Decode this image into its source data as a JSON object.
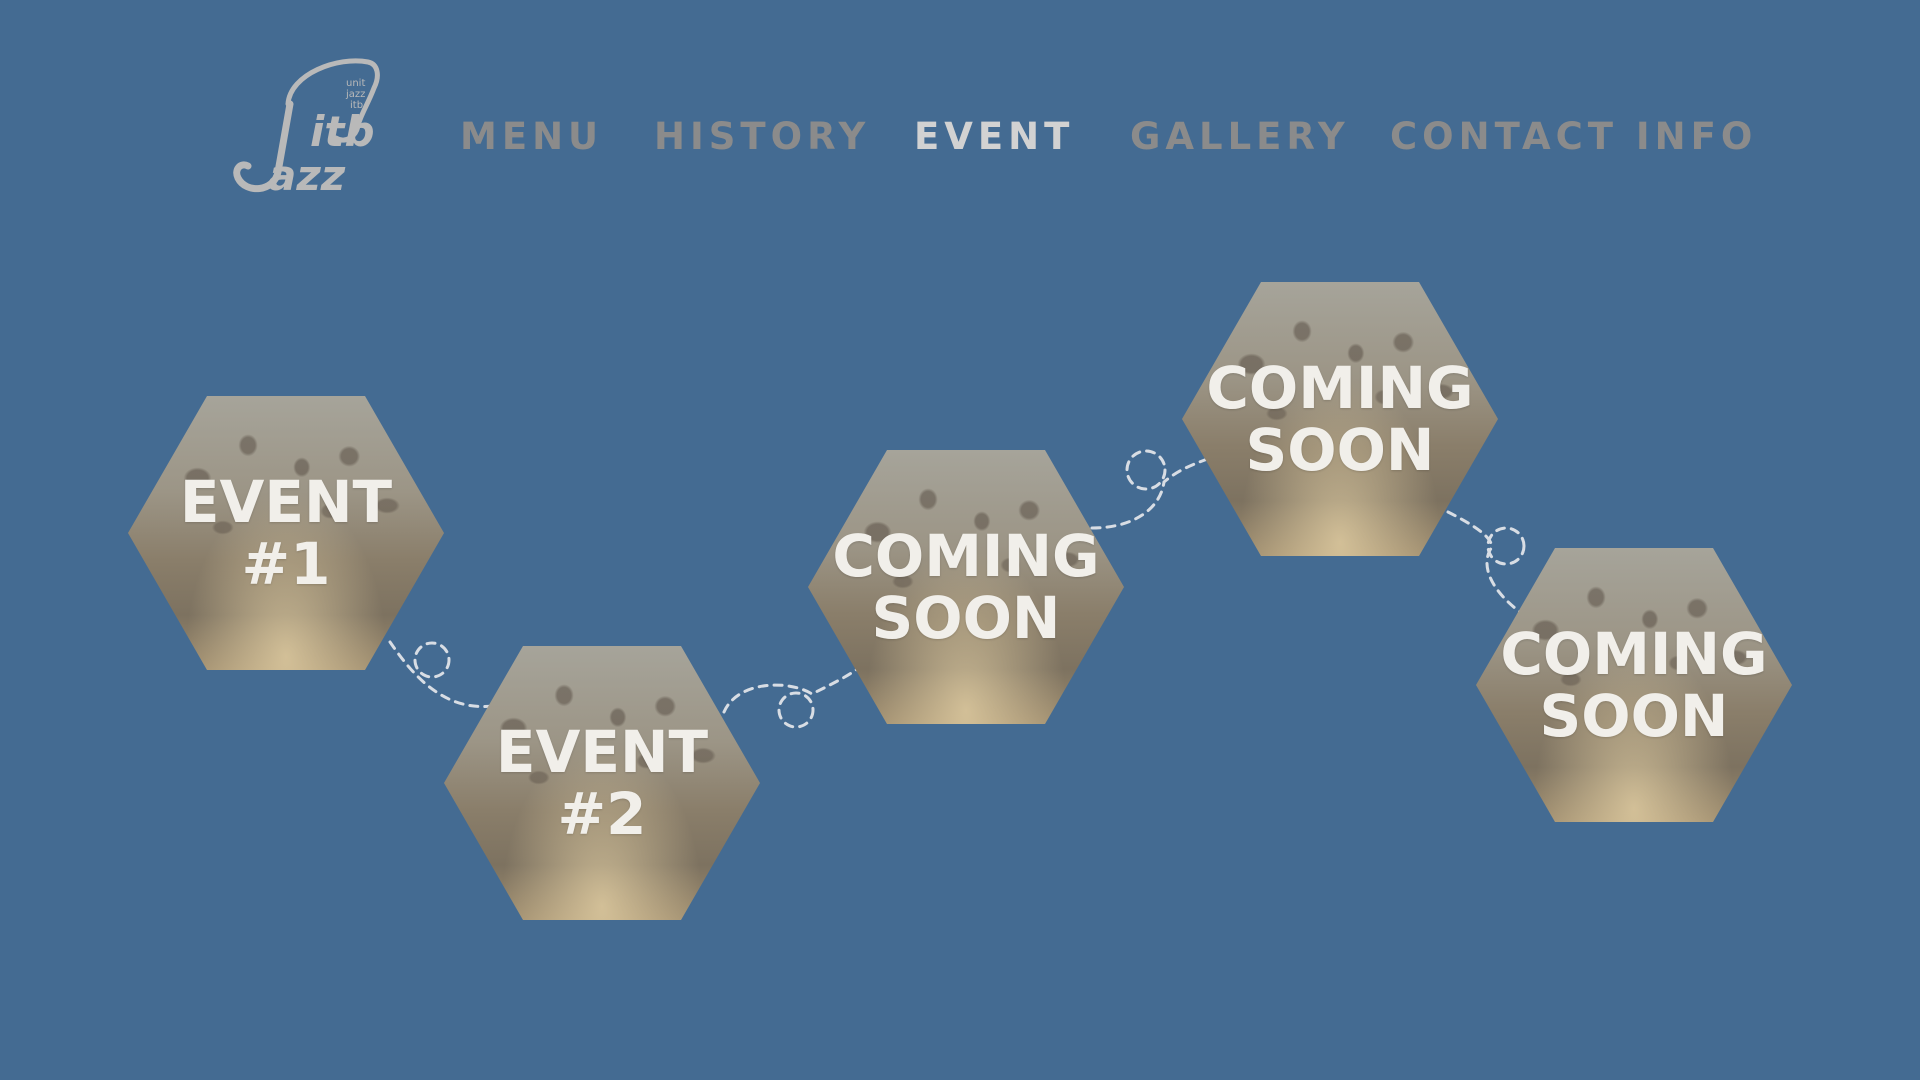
{
  "logo": {
    "script_text": "itb jazz",
    "small_lines": [
      "unit",
      "jazz",
      "itb"
    ]
  },
  "nav": {
    "items": [
      {
        "label": "MENU",
        "active": false
      },
      {
        "label": "HISTORY",
        "active": false
      },
      {
        "label": "EVENT",
        "active": true
      },
      {
        "label": "GALLERY",
        "active": false
      },
      {
        "label": "CONTACT INFO",
        "active": false
      }
    ]
  },
  "timeline": {
    "nodes": [
      {
        "line1": "EVENT",
        "line2": "#1"
      },
      {
        "line1": "EVENT",
        "line2": "#2"
      },
      {
        "line1": "COMING",
        "line2": "SOON"
      },
      {
        "line1": "COMING",
        "line2": "SOON"
      },
      {
        "line1": "COMING",
        "line2": "SOON"
      }
    ]
  },
  "colors": {
    "background": "#446b92",
    "nav_inactive": "#8b8b8b",
    "nav_active": "#d2d2d2",
    "hex_text": "#f1efea",
    "connector": "#d8dde4"
  }
}
